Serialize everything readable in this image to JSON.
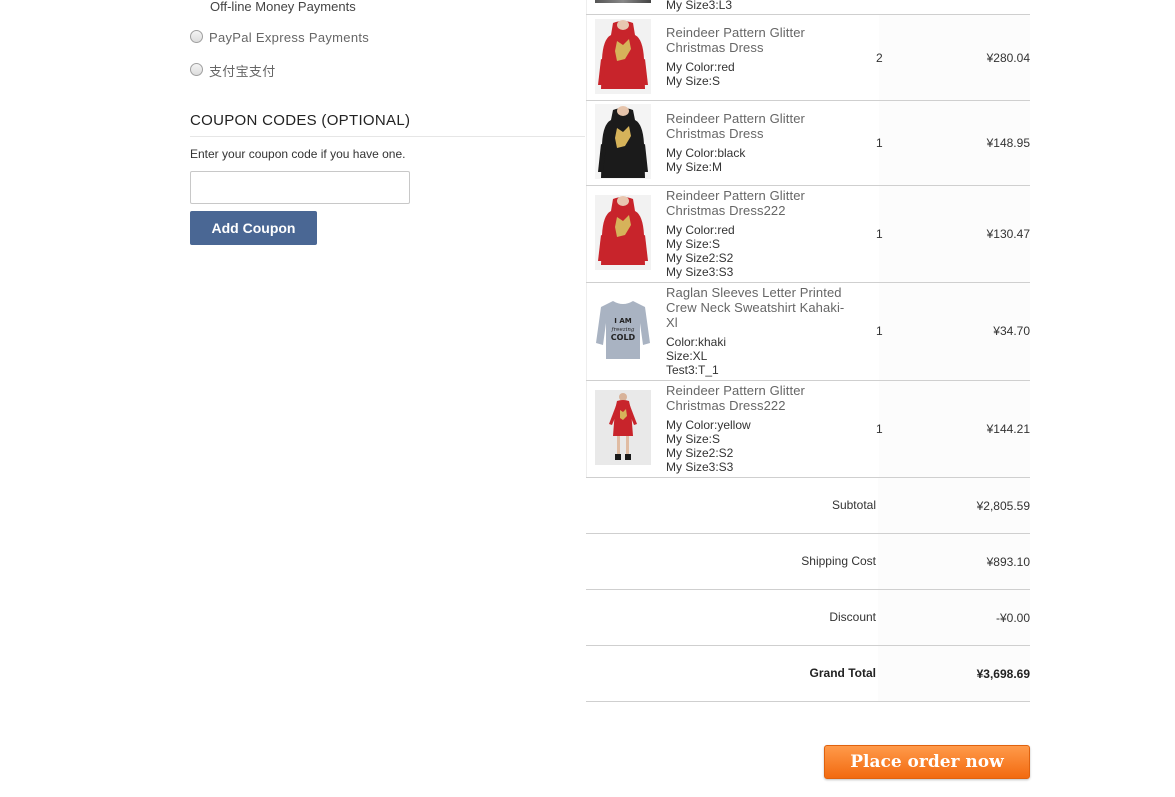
{
  "payment": {
    "offline_label": "Off-line Money Payments",
    "options": [
      {
        "label": "PayPal Express Payments"
      },
      {
        "label": "支付宝支付"
      }
    ]
  },
  "coupon": {
    "title": "COUPON CODES (OPTIONAL)",
    "hint": "Enter your coupon code if you have one.",
    "input_value": "",
    "button_label": "Add Coupon"
  },
  "order": {
    "top_row_tail": "My Size3:L3",
    "items": [
      {
        "name": "Reindeer Pattern Glitter Christmas Dress",
        "attributes": [
          "My Color:red",
          "My Size:S"
        ],
        "qty": "2",
        "price": "¥280.04",
        "thumb": "red-reindeer-dress-image"
      },
      {
        "name": "Reindeer Pattern Glitter Christmas Dress",
        "attributes": [
          "My Color:black",
          "My Size:M"
        ],
        "qty": "1",
        "price": "¥148.95",
        "thumb": "black-reindeer-dress-image"
      },
      {
        "name": "Reindeer Pattern Glitter Christmas Dress222",
        "attributes": [
          "My Color:red",
          "My Size:S",
          "My Size2:S2",
          "My Size3:S3"
        ],
        "qty": "1",
        "price": "¥130.47",
        "thumb": "red-reindeer-dress-image"
      },
      {
        "name": "Raglan Sleeves Letter Printed Crew Neck Sweatshirt Kahaki-Xl",
        "attributes": [
          "Color:khaki",
          "Size:XL",
          "Test3:T_1"
        ],
        "qty": "1",
        "price": "¥34.70",
        "thumb": "grey-sweatshirt-image",
        "thumb_text": [
          "I AM",
          "freezing",
          "COLD"
        ]
      },
      {
        "name": "Reindeer Pattern Glitter Christmas Dress222",
        "attributes": [
          "My Color:yellow",
          "My Size:S",
          "My Size2:S2",
          "My Size3:S3"
        ],
        "qty": "1",
        "price": "¥144.21",
        "thumb": "red-dress-full-body-image"
      }
    ],
    "summary": {
      "subtotal_label": "Subtotal",
      "subtotal_value": "¥2,805.59",
      "shipping_label": "Shipping Cost",
      "shipping_value": "¥893.10",
      "discount_label": "Discount",
      "discount_value": "-¥0.00",
      "grand_label": "Grand Total",
      "grand_value": "¥3,698.69"
    },
    "place_order_label": "Place order now"
  },
  "colors": {
    "coupon_button": "#4a6794",
    "place_order": "#f26a10",
    "dress_red": "#c8242b"
  }
}
